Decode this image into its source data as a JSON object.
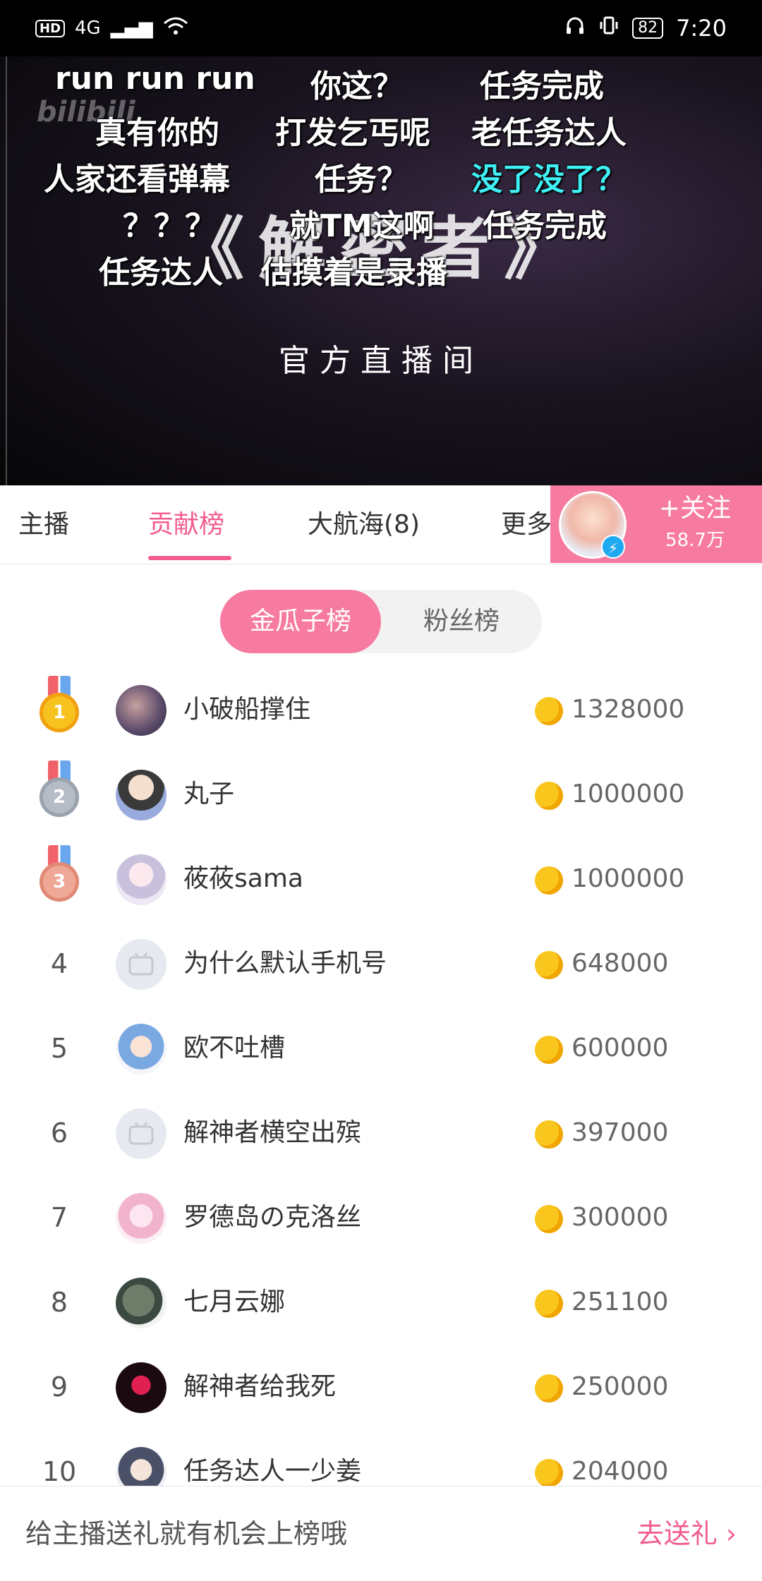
{
  "status_bar": {
    "hd": "HD",
    "network": "4G",
    "battery": "82",
    "time": "7:20"
  },
  "video": {
    "title": "《解密者》",
    "subtitle": "官方直播间",
    "danmaku": [
      {
        "text": "run run run",
        "cyan": false
      },
      {
        "text": "你这？",
        "cyan": false
      },
      {
        "text": "任务完成",
        "cyan": false
      },
      {
        "text": "真有你的",
        "cyan": false
      },
      {
        "text": "打发乞丐呢",
        "cyan": false
      },
      {
        "text": "老任务达人",
        "cyan": false
      },
      {
        "text": "人家还看弹幕",
        "cyan": false
      },
      {
        "text": "任务？",
        "cyan": false
      },
      {
        "text": "没了没了？",
        "cyan": true
      },
      {
        "text": "？？？",
        "cyan": false
      },
      {
        "text": "就TM这啊",
        "cyan": false
      },
      {
        "text": "任务完成",
        "cyan": false
      },
      {
        "text": "任务达人",
        "cyan": false
      },
      {
        "text": "估摸着是录播",
        "cyan": false
      }
    ]
  },
  "tabs": [
    {
      "label": "主播"
    },
    {
      "label": "贡献榜"
    },
    {
      "label": "大航海(8)"
    },
    {
      "label": "更多"
    }
  ],
  "follow": {
    "label": "+关注",
    "count": "58.7万"
  },
  "segment": {
    "active": "金瓜子榜",
    "inactive": "粉丝榜"
  },
  "ranking": [
    {
      "rank": "1",
      "name": "小破船撑住",
      "coins": "1328000"
    },
    {
      "rank": "2",
      "name": "丸子",
      "coins": "1000000"
    },
    {
      "rank": "3",
      "name": "莜莜sama",
      "coins": "1000000"
    },
    {
      "rank": "4",
      "name": "为什么默认手机号",
      "coins": "648000"
    },
    {
      "rank": "5",
      "name": "欧不吐槽",
      "coins": "600000"
    },
    {
      "rank": "6",
      "name": "解神者横空出殡",
      "coins": "397000"
    },
    {
      "rank": "7",
      "name": "罗德岛の克洛丝",
      "coins": "300000"
    },
    {
      "rank": "8",
      "name": "七月云娜",
      "coins": "251100"
    },
    {
      "rank": "9",
      "name": "解神者给我死",
      "coins": "250000"
    },
    {
      "rank": "10",
      "name": "任务达人一少姜",
      "coins": "204000"
    }
  ],
  "bottom": {
    "hint": "给主播送礼就有机会上榜哦",
    "action": "去送礼 ›"
  }
}
